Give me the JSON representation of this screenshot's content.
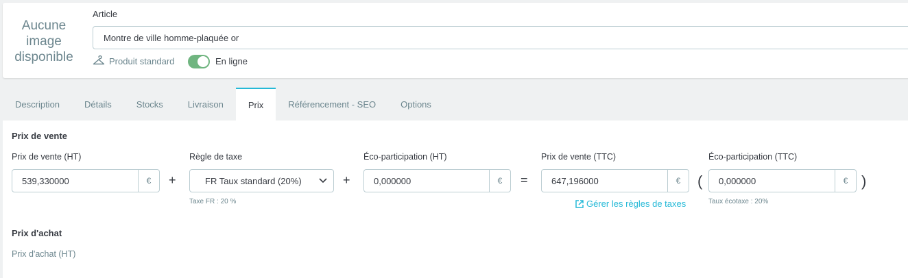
{
  "header": {
    "no_image_text": "Aucune image disponible",
    "article_label": "Article",
    "product_name": "Montre de ville homme-plaquée or",
    "product_type": "Produit standard",
    "online_label": "En ligne",
    "online_enabled": true
  },
  "tabs": [
    {
      "label": "Description",
      "active": false
    },
    {
      "label": "Détails",
      "active": false
    },
    {
      "label": "Stocks",
      "active": false
    },
    {
      "label": "Livraison",
      "active": false
    },
    {
      "label": "Prix",
      "active": true
    },
    {
      "label": "Référencement - SEO",
      "active": false
    },
    {
      "label": "Options",
      "active": false
    }
  ],
  "pricing": {
    "section_title": "Prix de vente",
    "price_ht_label": "Prix de vente (HT)",
    "price_ht_value": "539,330000",
    "currency": "€",
    "plus_sign": "+",
    "equals_sign": "=",
    "open_paren": "(",
    "close_paren": ")",
    "tax_rule_label": "Règle de taxe",
    "tax_rule_value": "FR Taux standard (20%)",
    "tax_note": "Taxe  FR : 20 %",
    "eco_ht_label": "Éco-participation (HT)",
    "eco_ht_value": "0,000000",
    "price_ttc_label": "Prix de vente (TTC)",
    "price_ttc_value": "647,196000",
    "manage_tax_link": "Gérer les règles de taxes",
    "eco_ttc_label": "Éco-participation (TTC)",
    "eco_ttc_value": "0,000000",
    "eco_tax_note": "Taux écotaxe : 20%"
  },
  "purchase": {
    "section_title": "Prix d'achat",
    "purchase_ht_label": "Prix d'achat (HT)"
  },
  "colors": {
    "accent": "#25b9d7",
    "toggle_on": "#70b580",
    "border": "#bbcdd2",
    "muted_text": "#6c868e"
  }
}
